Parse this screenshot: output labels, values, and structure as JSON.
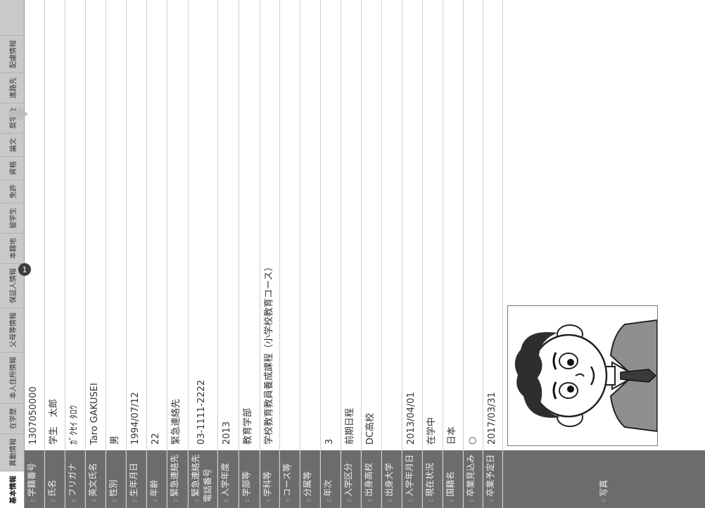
{
  "tabs": [
    {
      "label": "基本情報",
      "active": true
    },
    {
      "label": "異動情報"
    },
    {
      "label": "在学歴"
    },
    {
      "label": "本人住所情報"
    },
    {
      "label": "父母等情報"
    },
    {
      "label": "保証人情報"
    },
    {
      "label": "本籍地"
    },
    {
      "label": "留学生"
    },
    {
      "label": "免許"
    },
    {
      "label": "資格"
    },
    {
      "label": "論文"
    },
    {
      "label": "奨学金"
    },
    {
      "label": "進路先"
    },
    {
      "label": "配慮情報"
    }
  ],
  "annotation_badge": "1",
  "fields": [
    {
      "label": "学籍番号",
      "value": "1307050000"
    },
    {
      "label": "氏名",
      "value": "学生　太郎"
    },
    {
      "label": "フリガナ",
      "value": "ｶﾞｸｾｲ ﾀﾛｳ"
    },
    {
      "label": "英文氏名",
      "value": "Taro GAKUSEI"
    },
    {
      "label": "性別",
      "value": "男"
    },
    {
      "label": "生年月日",
      "value": "1994/07/12"
    },
    {
      "label": "年齢",
      "value": "22"
    },
    {
      "label": "緊急連絡先",
      "value": "緊急連絡先"
    },
    {
      "label": "緊急連絡先電話番号",
      "value": "03-1111-2222"
    },
    {
      "label": "入学年度",
      "value": "2013"
    },
    {
      "label": "学部等",
      "value": "教育学部"
    },
    {
      "label": "学科等",
      "value": "学校教育教員養成課程（小学校教育コース）"
    },
    {
      "label": "コース等",
      "value": ""
    },
    {
      "label": "分属等",
      "value": ""
    },
    {
      "label": "年次",
      "value": "3"
    },
    {
      "label": "入学区分",
      "value": "前期日程"
    },
    {
      "label": "出身高校",
      "value": "DC高校"
    },
    {
      "label": "出身大学",
      "value": ""
    },
    {
      "label": "入学年月日",
      "value": "2013/04/01"
    },
    {
      "label": "現在状況",
      "value": "在学中"
    },
    {
      "label": "国籍名",
      "value": "日本"
    },
    {
      "label": "卒業見込み",
      "value": "○"
    },
    {
      "label": "卒業予定日",
      "value": "2017/03/31"
    }
  ],
  "photo_label": "写真",
  "bullet": "::"
}
